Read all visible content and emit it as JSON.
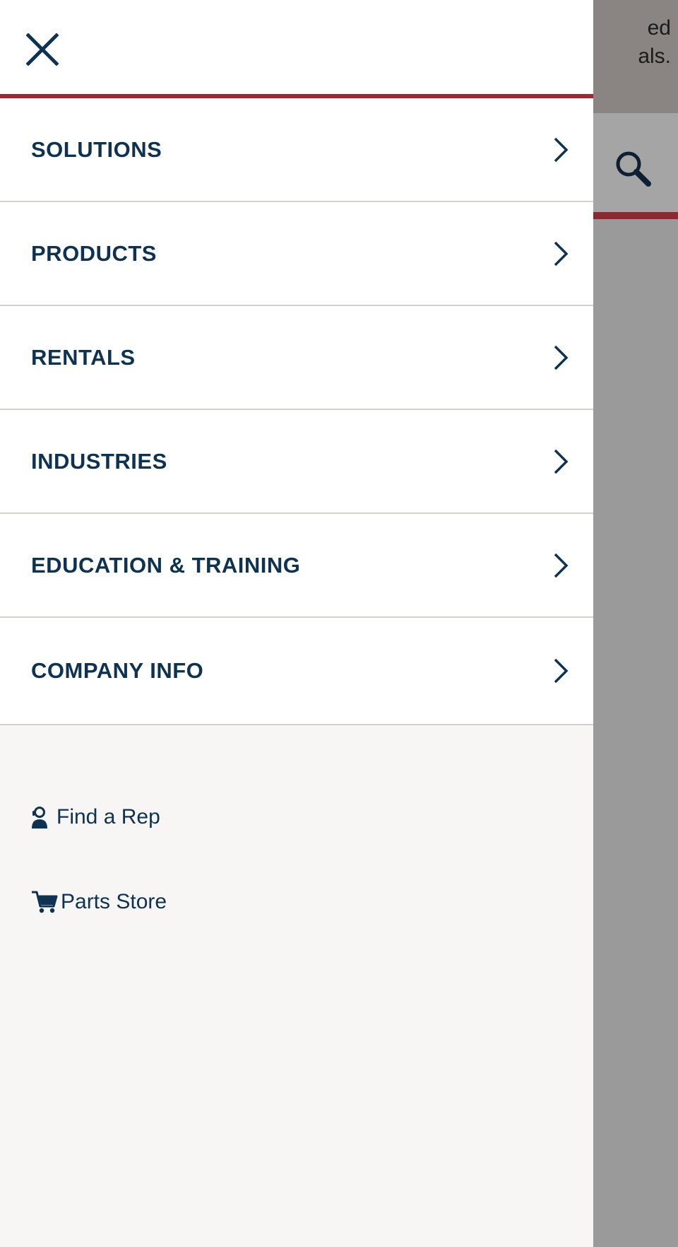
{
  "background": {
    "banner_text": "ed\nals."
  },
  "drawer": {
    "menu": [
      {
        "label": "SOLUTIONS"
      },
      {
        "label": "PRODUCTS"
      },
      {
        "label": "RENTALS"
      },
      {
        "label": "INDUSTRIES"
      },
      {
        "label": "EDUCATION & TRAINING"
      },
      {
        "label": "COMPANY INFO"
      }
    ],
    "links": {
      "find_rep": "Find a Rep",
      "parts_store": "Parts Store"
    }
  },
  "colors": {
    "brand_navy": "#0d3252",
    "accent_red": "#a3262f",
    "divider": "#d4d2cc",
    "overlay_gray": "#9a9a9a"
  },
  "icons": {
    "close": "close-icon",
    "chevron": "chevron-right-icon",
    "search": "search-icon",
    "rep": "support-rep-icon",
    "cart": "cart-icon"
  }
}
